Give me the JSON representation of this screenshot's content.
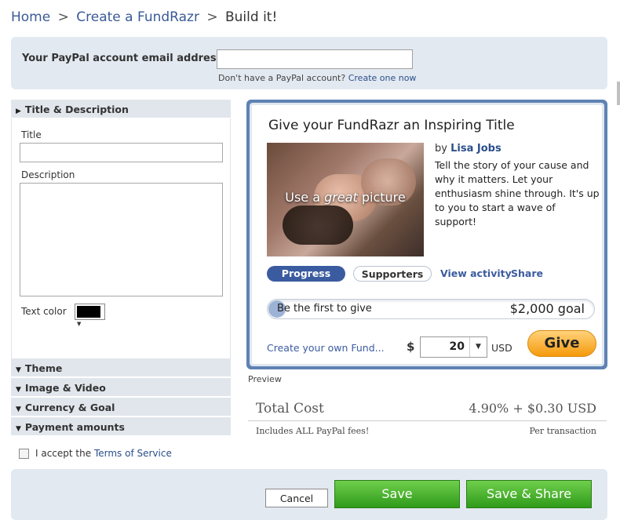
{
  "breadcrumb": {
    "home": "Home",
    "create": "Create a FundRazr",
    "current": "Build it!",
    "separator": ">"
  },
  "paypal": {
    "label": "Your PayPal account email address",
    "value": "",
    "help_text": "Don't have a PayPal account?",
    "help_link": "Create one now"
  },
  "sections": {
    "title_description": "Title & Description",
    "theme": "Theme",
    "image_video": "Image & Video",
    "currency_goal": "Currency & Goal",
    "payment_amounts": "Payment amounts"
  },
  "form": {
    "title_label": "Title",
    "title_value": "",
    "description_label": "Description",
    "description_value": "",
    "text_color_label": "Text color",
    "text_color": "#000000"
  },
  "widget": {
    "title": "Give your FundRazr an Inspiring Title",
    "image_caption_pre": "Use a ",
    "image_caption_em": "great",
    "image_caption_post": " picture",
    "by": "by",
    "author": "Lisa  Jobs",
    "story": "Tell the story of your cause and why it matters. Let your enthusiasm shine through. It's up to you to start a wave of support!",
    "tabs": {
      "progress": "Progress",
      "supporters": "Supporters",
      "activity": "View activity",
      "share": "Share"
    },
    "progress_text": "Be the first to give",
    "goal_text": "$2,000 goal",
    "create_own": "Create your own Fund...",
    "currency_symbol": "$",
    "amount": "20",
    "currency_code": "USD",
    "give_label": "Give"
  },
  "preview_label": "Preview",
  "cost": {
    "title": "Total Cost",
    "value": "4.90% + $0.30  USD",
    "note": "Includes ALL PayPal fees!",
    "per": "Per transaction"
  },
  "terms": {
    "prefix": "I accept the",
    "link": "Terms of Service"
  },
  "actions": {
    "cancel": "Cancel",
    "save": "Save",
    "save_share": "Save & Share"
  },
  "colors": {
    "accent": "#3b5ba0",
    "give": "#f59a0c",
    "save": "#3aa52a",
    "panel": "#e3e9f1"
  }
}
